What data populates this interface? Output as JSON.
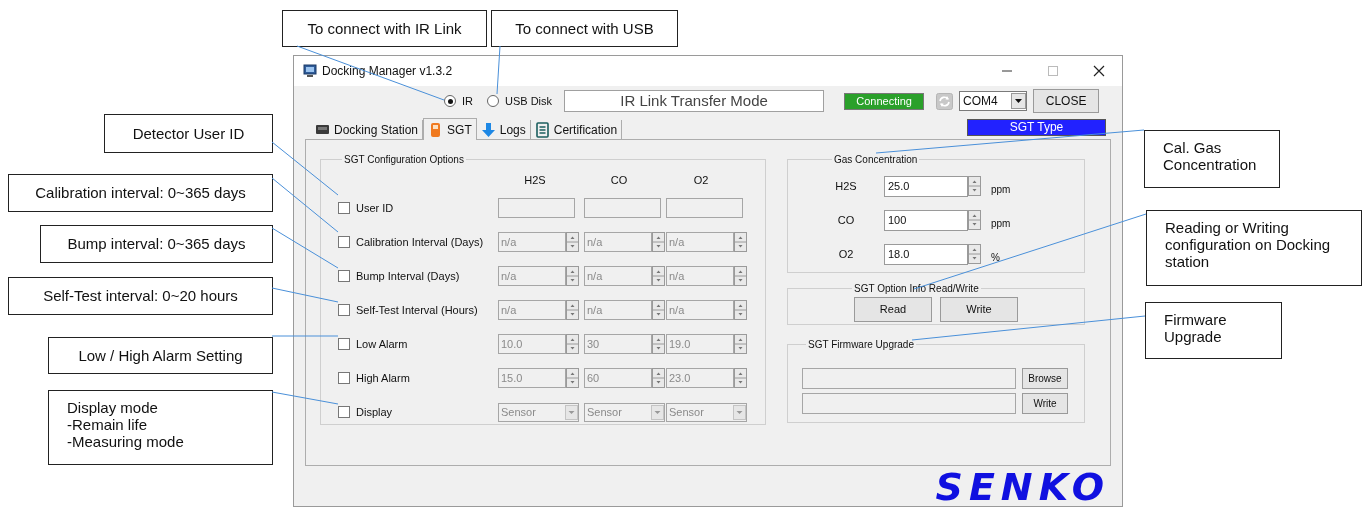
{
  "annotations": [
    {
      "lines": [
        "To connect with IR Link"
      ]
    },
    {
      "lines": [
        "To connect with USB"
      ]
    },
    {
      "lines": [
        "Detector User ID"
      ]
    },
    {
      "lines": [
        "Calibration interval: 0~365 days"
      ]
    },
    {
      "lines": [
        "Bump interval: 0~365 days"
      ]
    },
    {
      "lines": [
        "Self-Test interval: 0~20 hours"
      ]
    },
    {
      "lines": [
        "Low / High Alarm Setting"
      ]
    },
    {
      "lines": [
        "Display mode",
        "-Remain life",
        "-Measuring mode"
      ]
    },
    {
      "lines": [
        "Cal. Gas Concentration"
      ]
    },
    {
      "lines": [
        "Reading or Writing configuration on Docking station"
      ]
    },
    {
      "lines": [
        "Firmware Upgrade"
      ]
    }
  ],
  "window": {
    "title": "Docking Manager v1.3.2"
  },
  "connection": [
    {
      "label": "IR",
      "selected": true
    },
    {
      "label": "USB Disk",
      "selected": false
    }
  ],
  "mode_text": "IR Link Transfer Mode",
  "status": "Connecting",
  "port": "COM4",
  "close_button": "CLOSE",
  "tabs": [
    {
      "label": "Docking Station",
      "kind": "station",
      "selected": false
    },
    {
      "label": "SGT",
      "kind": "device",
      "selected": true
    },
    {
      "label": "Logs",
      "kind": "logs",
      "selected": false
    },
    {
      "label": "Certification",
      "kind": "document",
      "selected": false
    }
  ],
  "device_type": "SGT Type",
  "config": {
    "title": "SGT Configuration Options",
    "columns": [
      "H2S",
      "CO",
      "O2"
    ],
    "rows": [
      {
        "label": "User ID",
        "checked": false,
        "kind": "text",
        "disabled": true
      },
      {
        "label": "Calibration Interval (Days)",
        "checked": false,
        "kind": "spin",
        "disabled": true,
        "values": [
          "n/a",
          "n/a",
          "n/a"
        ]
      },
      {
        "label": "Bump Interval (Days)",
        "checked": false,
        "kind": "spin",
        "disabled": true,
        "values": [
          "n/a",
          "n/a",
          "n/a"
        ]
      },
      {
        "label": "Self-Test Interval (Hours)",
        "checked": false,
        "kind": "spin",
        "disabled": true,
        "values": [
          "n/a",
          "n/a",
          "n/a"
        ]
      },
      {
        "label": "Low Alarm",
        "checked": false,
        "kind": "spin",
        "disabled": true,
        "values": [
          "10.0",
          "30",
          "19.0"
        ]
      },
      {
        "label": "High Alarm",
        "checked": false,
        "kind": "spin",
        "disabled": true,
        "values": [
          "15.0",
          "60",
          "23.0"
        ]
      },
      {
        "label": "Display",
        "checked": false,
        "kind": "select",
        "disabled": true,
        "values": [
          "Sensor",
          "Sensor",
          "Sensor"
        ]
      }
    ]
  },
  "gas": {
    "title": "Gas Concentration",
    "rows": [
      {
        "label": "H2S",
        "value": "25.0",
        "unit": "ppm"
      },
      {
        "label": "CO",
        "value": "100",
        "unit": "ppm"
      },
      {
        "label": "O2",
        "value": "18.0",
        "unit": "%"
      }
    ]
  },
  "option_info": {
    "title": "SGT Option Info Read/Write",
    "buttons": [
      "Read",
      "Write"
    ]
  },
  "firmware": {
    "title": "SGT Firmware Upgrade",
    "buttons": [
      "Browse",
      "Write"
    ]
  },
  "logo": "SENKO"
}
